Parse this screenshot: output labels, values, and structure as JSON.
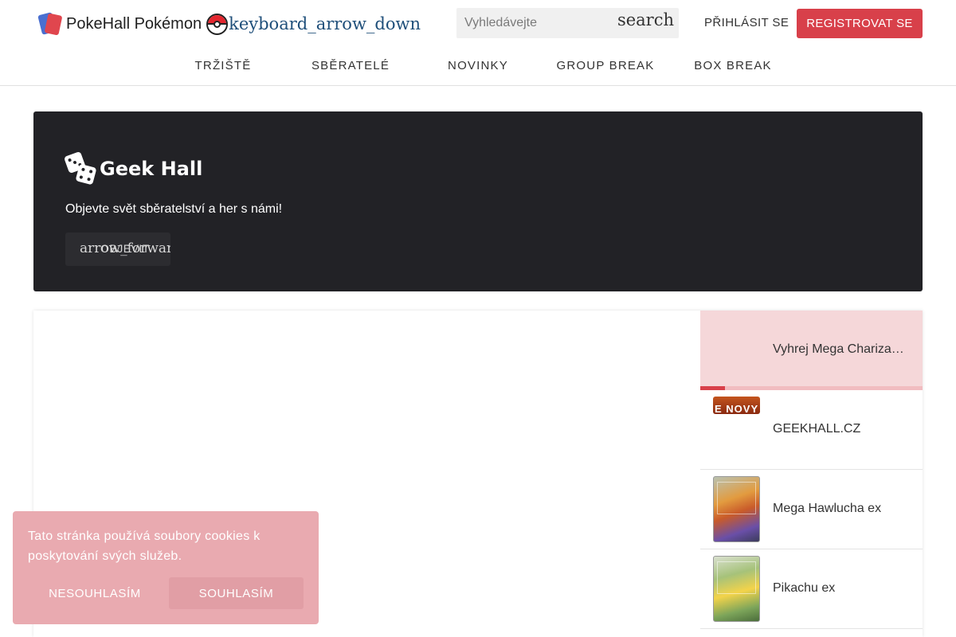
{
  "header": {
    "brand_name": "PokeHall Pokémon",
    "dropdown_icon_text": "keyboard_arrow_down",
    "search": {
      "placeholder": "Vyhledávejte",
      "button_text": "search"
    },
    "login_label": "PŘIHLÁSIT SE",
    "register_label": "REGISTROVAT SE"
  },
  "nav": {
    "items": [
      {
        "label": "TRŽIŠTĚ"
      },
      {
        "label": "SBĚRATELÉ"
      },
      {
        "label": "NOVINKY"
      },
      {
        "label": "GROUP BREAK"
      },
      {
        "label": "BOX BREAK"
      }
    ]
  },
  "hero": {
    "logo_text": "Geek Hall",
    "subtitle": "Objevte svět sběratelství a her s námi!",
    "button_icon_text": "arrow_forward",
    "button_label": "OBJEVIT"
  },
  "slider": {
    "items": [
      {
        "title": "Vyhrej Mega Chariza…"
      },
      {
        "title": "GEEKHALL.CZ",
        "thumb_text": "E NOVY"
      },
      {
        "title": "Mega Hawlucha ex"
      },
      {
        "title": "Pikachu ex"
      }
    ]
  },
  "cookie": {
    "text": "Tato stránka používá soubory cookies k poskytování svých služeb.",
    "decline_label": "NESOUHLASÍM",
    "accept_label": "SOUHLASÍM"
  },
  "colors": {
    "accent_red": "#d8404a",
    "hero_bg": "#222226",
    "cookie_bg": "#e9aab0",
    "active_item_bg": "#f5d7d9"
  }
}
